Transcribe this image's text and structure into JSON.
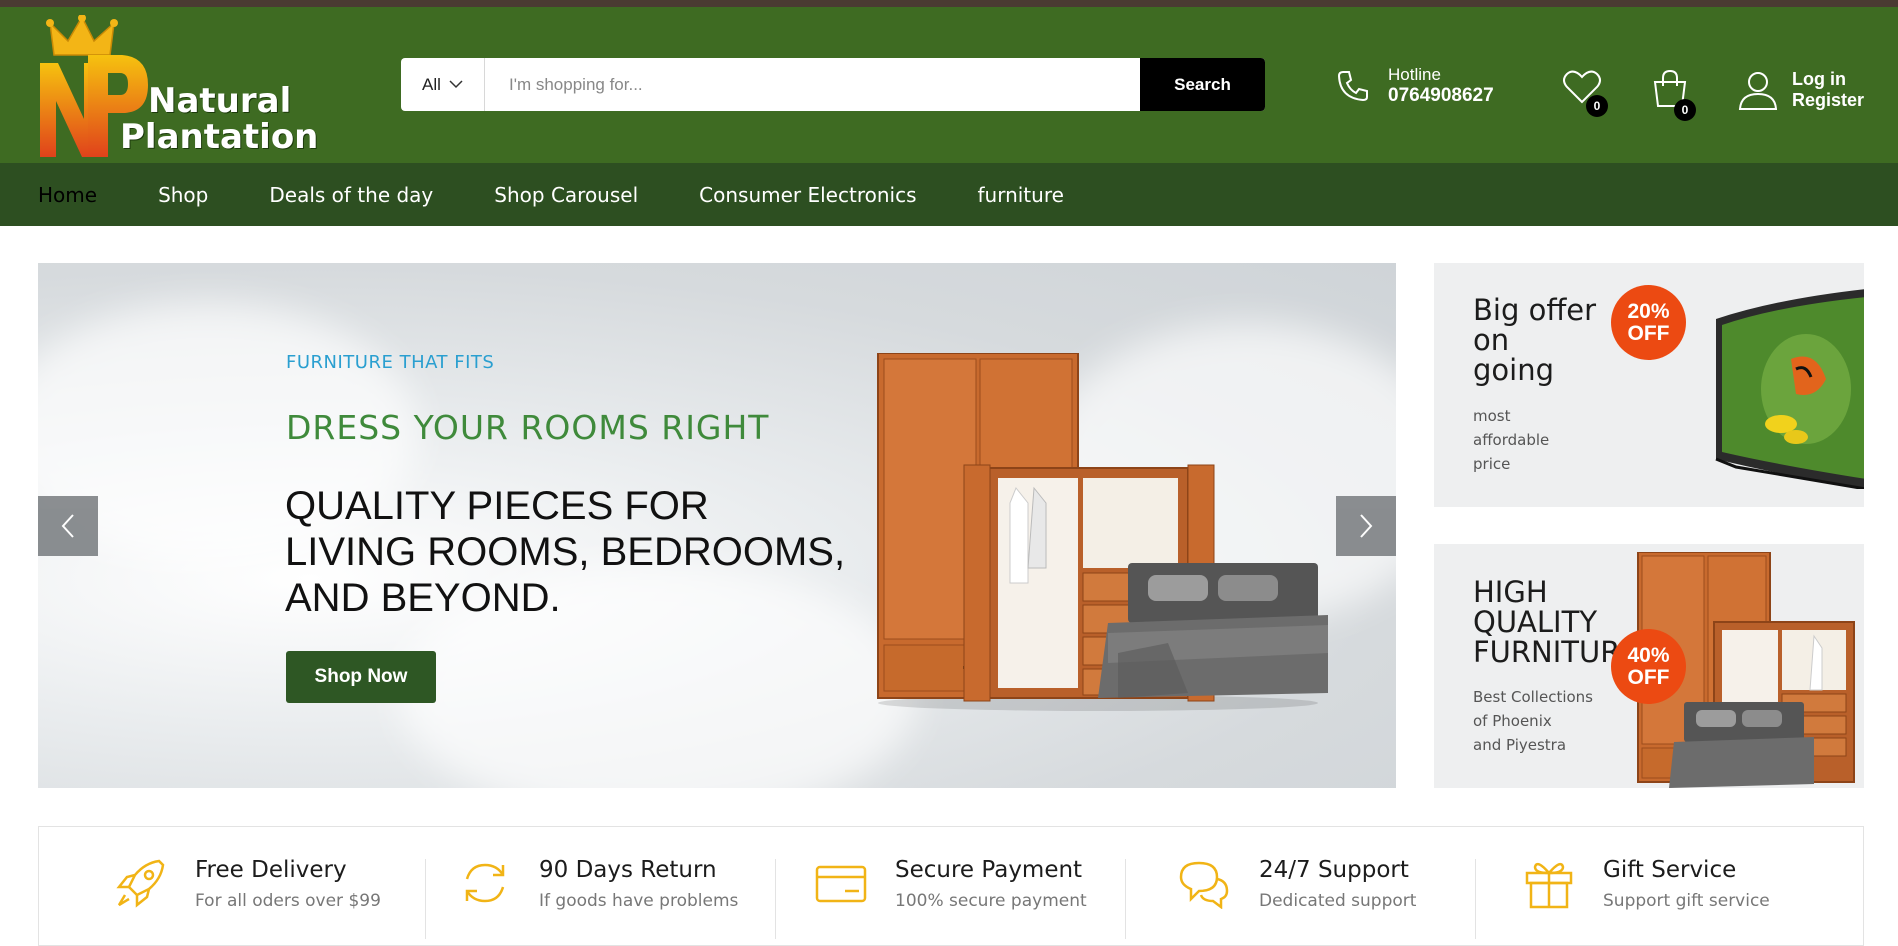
{
  "brand": {
    "line1": "Natural",
    "line2": "Plantation"
  },
  "search": {
    "category": "All",
    "placeholder": "I'm shopping for...",
    "button": "Search"
  },
  "hotline": {
    "label": "Hotline",
    "number": "0764908627"
  },
  "wishlist": {
    "count": "0"
  },
  "cart": {
    "count": "0"
  },
  "account": {
    "login": "Log in",
    "register": "Register"
  },
  "nav": [
    "Home",
    "Shop",
    "Deals of the day",
    "Shop Carousel",
    "Consumer Electronics",
    "furniture"
  ],
  "hero": {
    "kicker": "FURNITURE THAT FITS",
    "title": "DRESS YOUR ROOMS RIGHT",
    "subtitle_lines": [
      "QUALITY PIECES FOR",
      "LIVING ROOMS, BEDROOMS,",
      "AND BEYOND."
    ],
    "button": "Shop Now"
  },
  "banners": [
    {
      "title_lines": [
        "Big offer",
        "on",
        "going"
      ],
      "desc_lines": [
        "most",
        "affordable",
        "price"
      ],
      "offer_pct": "20%",
      "offer_word": "OFF"
    },
    {
      "title_lines": [
        "HIGH",
        "QUALITY",
        "FURNITURE"
      ],
      "desc_lines": [
        "Best Collections",
        "of Phoenix",
        "and Piyestra"
      ],
      "offer_pct": "40%",
      "offer_word": "OFF"
    }
  ],
  "features": [
    {
      "icon": "rocket-icon",
      "title": "Free Delivery",
      "desc": "For all oders over $99"
    },
    {
      "icon": "refresh-icon",
      "title": "90 Days Return",
      "desc": "If goods have problems"
    },
    {
      "icon": "credit-card-icon",
      "title": "Secure Payment",
      "desc": "100% secure payment"
    },
    {
      "icon": "chat-icon",
      "title": "24/7 Support",
      "desc": "Dedicated support"
    },
    {
      "icon": "gift-icon",
      "title": "Gift Service",
      "desc": "Support gift service"
    }
  ],
  "colors": {
    "header": "#3e6b22",
    "nav": "#2d4f21",
    "accent_orange": "#ec4a12",
    "feature_icon": "#f1b416"
  }
}
